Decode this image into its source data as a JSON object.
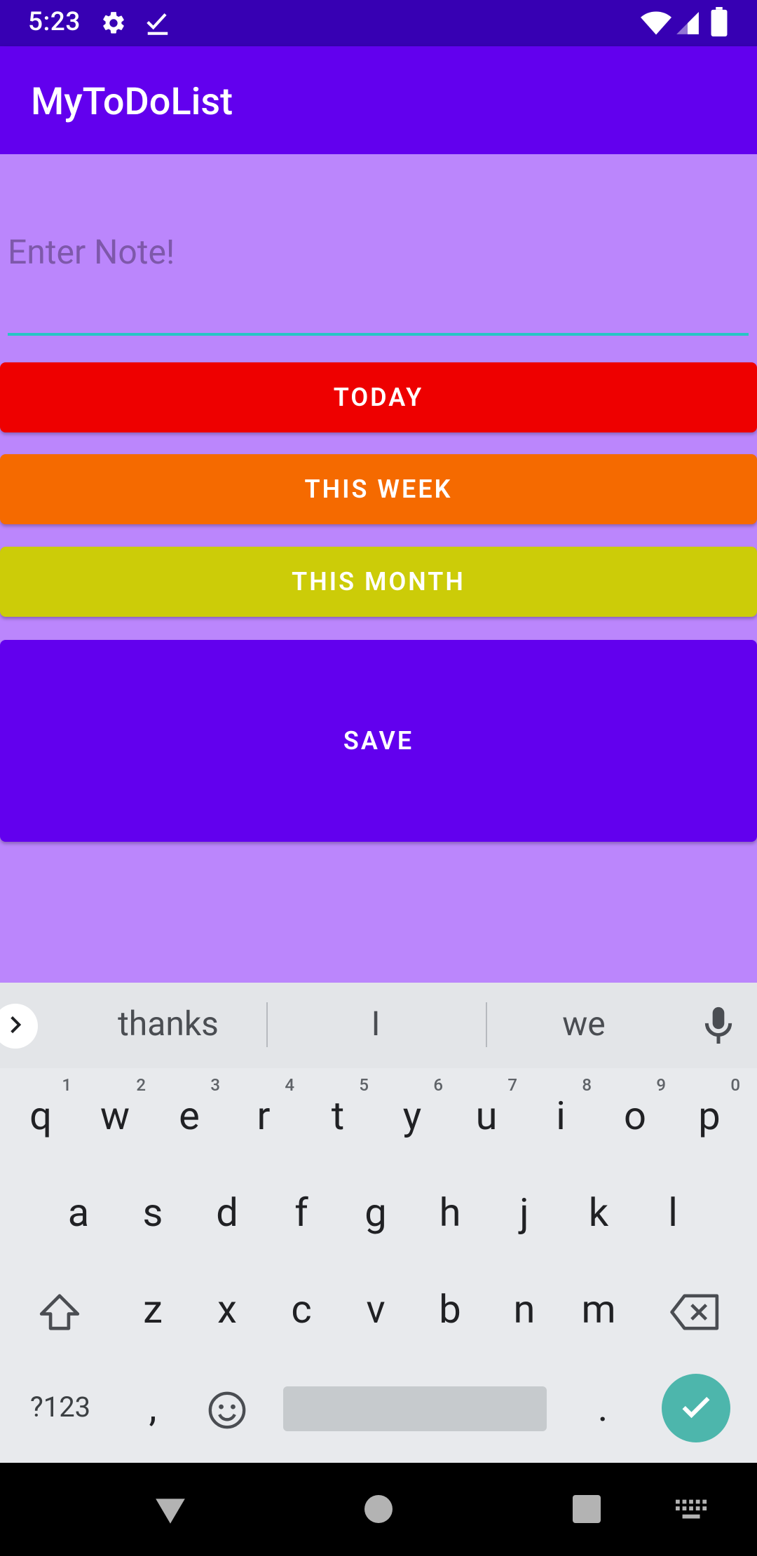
{
  "status_bar": {
    "time": "5:23",
    "icons": [
      "gear-icon",
      "check-icon",
      "wifi-icon",
      "signal-icon",
      "battery-icon"
    ]
  },
  "app_bar": {
    "title": "MyToDoList"
  },
  "note_input": {
    "placeholder": "Enter Note!",
    "value": ""
  },
  "buttons": {
    "today": "TODAY",
    "this_week": "THIS WEEK",
    "this_month": "THIS MONTH",
    "save": "SAVE"
  },
  "colors": {
    "status_bar": "#3700B3",
    "app_bar": "#6200EE",
    "background": "#BB86FC",
    "today": "#EE0000",
    "this_week": "#F56A00",
    "this_month": "#CCCC08",
    "save": "#6200EE",
    "accent": "#26C6C4"
  },
  "keyboard": {
    "suggestions": [
      "thanks",
      "I",
      "we"
    ],
    "row1": [
      {
        "k": "q",
        "h": "1"
      },
      {
        "k": "w",
        "h": "2"
      },
      {
        "k": "e",
        "h": "3"
      },
      {
        "k": "r",
        "h": "4"
      },
      {
        "k": "t",
        "h": "5"
      },
      {
        "k": "y",
        "h": "6"
      },
      {
        "k": "u",
        "h": "7"
      },
      {
        "k": "i",
        "h": "8"
      },
      {
        "k": "o",
        "h": "9"
      },
      {
        "k": "p",
        "h": "0"
      }
    ],
    "row2": [
      "a",
      "s",
      "d",
      "f",
      "g",
      "h",
      "j",
      "k",
      "l"
    ],
    "row3": [
      "z",
      "x",
      "c",
      "v",
      "b",
      "n",
      "m"
    ],
    "symbols_label": "?123",
    "comma": ",",
    "period": "."
  }
}
